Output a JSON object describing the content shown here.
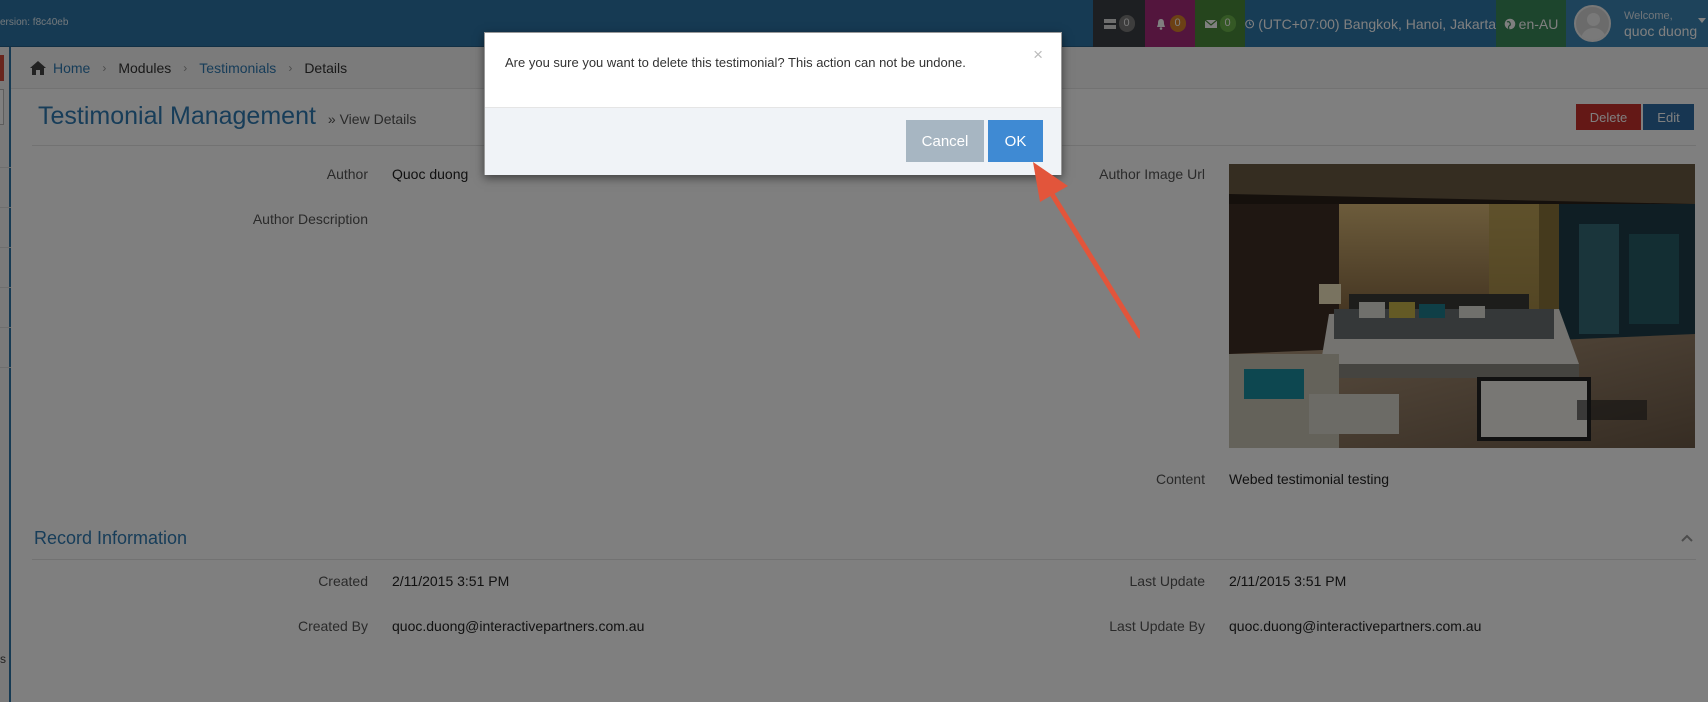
{
  "topbar": {
    "version": "ersion: f8c40eb",
    "notifications_count": "0",
    "alerts_count": "0",
    "messages_count": "0",
    "timezone": "(UTC+07:00) Bangkok, Hanoi, Jakarta",
    "language": "en-AU",
    "welcome": "Welcome,",
    "user_name": "quoc duong"
  },
  "breadcrumb": {
    "home": "Home",
    "modules": "Modules",
    "testimonials": "Testimonials",
    "details": "Details"
  },
  "page": {
    "title": "Testimonial Management",
    "subtitle": "» View Details",
    "delete_label": "Delete",
    "edit_label": "Edit"
  },
  "details": {
    "author_label": "Author",
    "author_value": "Quoc duong",
    "author_description_label": "Author Description",
    "author_image_url_label": "Author Image Url",
    "content_label": "Content",
    "content_value": "Webed testimonial testing"
  },
  "record": {
    "section_title": "Record Information",
    "created_label": "Created",
    "created_value": "2/11/2015 3:51 PM",
    "created_by_label": "Created By",
    "created_by_value": "quoc.duong@interactivepartners.com.au",
    "last_update_label": "Last Update",
    "last_update_value": "2/11/2015 3:51 PM",
    "last_update_by_label": "Last Update By",
    "last_update_by_value": "quoc.duong@interactivepartners.com.au"
  },
  "sidebar": {
    "bottom_letter": "s"
  },
  "modal": {
    "message": "Are you sure you want to delete this testimonial? This action can not be undone.",
    "close_glyph": "×",
    "cancel_label": "Cancel",
    "ok_label": "OK"
  },
  "colors": {
    "topbar": "#2c75a6",
    "delete": "#c9302c",
    "edit": "#2e6da4",
    "ok": "#3f8ad3",
    "cancel": "#a7b6c2",
    "arrow": "#e2553b"
  }
}
